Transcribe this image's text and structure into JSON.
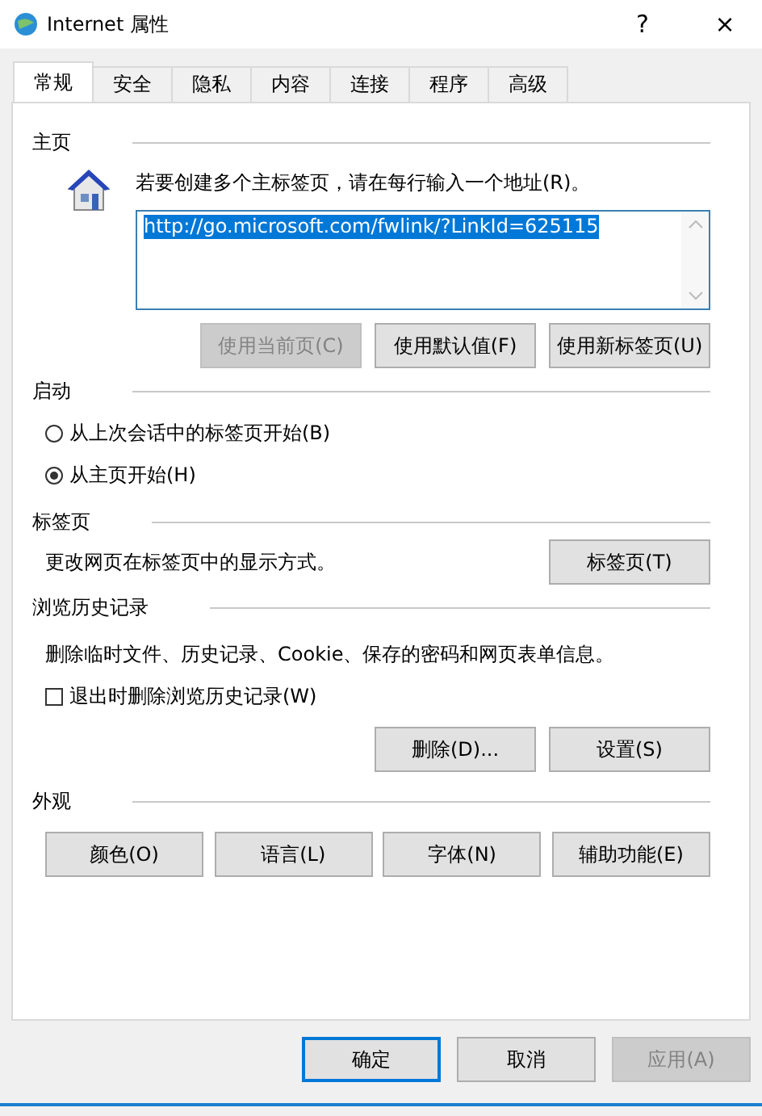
{
  "window": {
    "title": "Internet 属性",
    "help": "?",
    "close": "×"
  },
  "tabs": [
    {
      "label": "常规",
      "selected": true
    },
    {
      "label": "安全",
      "selected": false
    },
    {
      "label": "隐私",
      "selected": false
    },
    {
      "label": "内容",
      "selected": false
    },
    {
      "label": "连接",
      "selected": false
    },
    {
      "label": "程序",
      "selected": false
    },
    {
      "label": "高级",
      "selected": false
    }
  ],
  "home": {
    "heading": "主页",
    "hint": "若要创建多个主标签页，请在每行输入一个地址(R)。",
    "value": "http://go.microsoft.com/fwlink/?LinkId=625115",
    "buttons": [
      {
        "label": "使用当前页(C)",
        "disabled": true
      },
      {
        "label": "使用默认值(F)",
        "disabled": false
      },
      {
        "label": "使用新标签页(U)",
        "disabled": false
      }
    ]
  },
  "startup": {
    "heading": "启动",
    "options": [
      {
        "label": "从上次会话中的标签页开始(B)",
        "selected": false
      },
      {
        "label": "从主页开始(H)",
        "selected": true
      }
    ]
  },
  "tab_settings": {
    "heading": "标签页",
    "description": "更改网页在标签页中的显示方式。",
    "button": "标签页(T)"
  },
  "history": {
    "heading": "浏览历史记录",
    "description": "删除临时文件、历史记录、Cookie、保存的密码和网页表单信息。",
    "checkbox": {
      "label": "退出时删除浏览历史记录(W)",
      "checked": false
    },
    "buttons": [
      {
        "label": "删除(D)...",
        "disabled": false
      },
      {
        "label": "设置(S)",
        "disabled": false
      }
    ]
  },
  "appearance": {
    "heading": "外观",
    "buttons": [
      {
        "label": "颜色(O)",
        "disabled": false
      },
      {
        "label": "语言(L)",
        "disabled": false
      },
      {
        "label": "字体(N)",
        "disabled": false
      },
      {
        "label": "辅助功能(E)",
        "disabled": false
      }
    ]
  },
  "footer": [
    {
      "label": "确定",
      "default": true,
      "disabled": false
    },
    {
      "label": "取消",
      "default": false,
      "disabled": false
    },
    {
      "label": "应用(A)",
      "default": false,
      "disabled": true
    }
  ]
}
